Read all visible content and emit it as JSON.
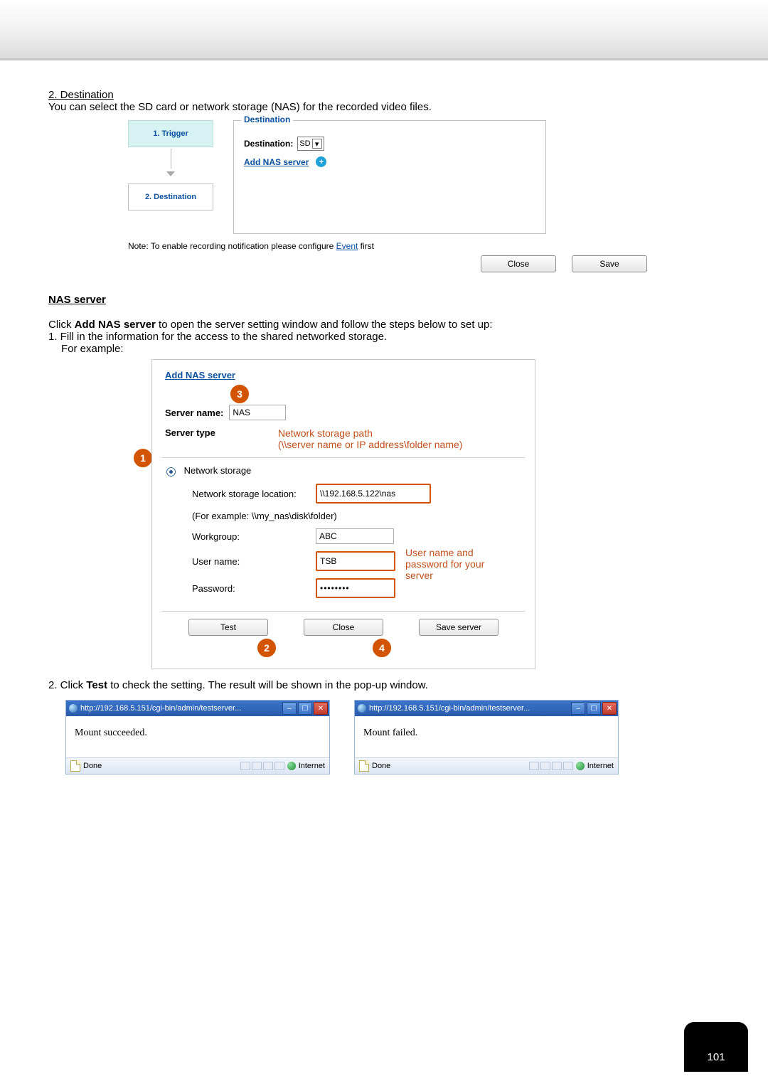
{
  "section": {
    "heading": "2. Destination",
    "desc": "You can select the SD card or network storage (NAS) for the recorded video files."
  },
  "destPanel": {
    "step1": "1.  Trigger",
    "step2": "2.  Destination",
    "legend": "Destination",
    "destLabel": "Destination:",
    "destValue": "SD",
    "addNas": "Add NAS server",
    "noteBefore": "Note: To enable recording notification please configure ",
    "noteLink": "Event",
    "noteAfter": " first",
    "closeBtn": "Close",
    "saveBtn": "Save"
  },
  "nasHead": "NAS server",
  "nasIntro": {
    "line1a": "Click ",
    "line1b": "Add NAS server",
    "line1c": " to open the server setting window and follow the steps below to set up:",
    "line2": "1. Fill in the information for the access to the shared networked storage.",
    "line3": "For example:"
  },
  "nasDialog": {
    "title": "Add NAS server",
    "serverNameLbl": "Server name:",
    "serverNameVal": "NAS",
    "serverTypeLbl": "Server type",
    "anno_path1": "Network storage path",
    "anno_path2": "(\\\\server name or IP address\\folder name)",
    "radioLabel": "Network storage",
    "locLbl": "Network storage location:",
    "locVal": "\\\\192.168.5.122\\nas",
    "locExample": "(For example: \\\\my_nas\\disk\\folder)",
    "wgLbl": "Workgroup:",
    "wgVal": "ABC",
    "userLbl": "User name:",
    "userVal": "TSB",
    "pwdLbl": "Password:",
    "pwdVal": "••••••••",
    "anno_cred1": "User name and",
    "anno_cred2": "password for your",
    "anno_cred3": "server",
    "testBtn": "Test",
    "closeBtn": "Close",
    "saveBtn": "Save server",
    "badge1": "1",
    "badge2": "2",
    "badge3": "3",
    "badge4": "4"
  },
  "testLine": {
    "a": "2. Click ",
    "b": "Test",
    "c": " to check the setting. The result will be shown in the pop-up window."
  },
  "popup": {
    "url": "http://192.168.5.151/cgi-bin/admin/testserver...",
    "msgOk": "Mount succeeded.",
    "msgFail": "Mount failed.",
    "done": "Done",
    "zone": "Internet"
  },
  "pageNum": "101"
}
